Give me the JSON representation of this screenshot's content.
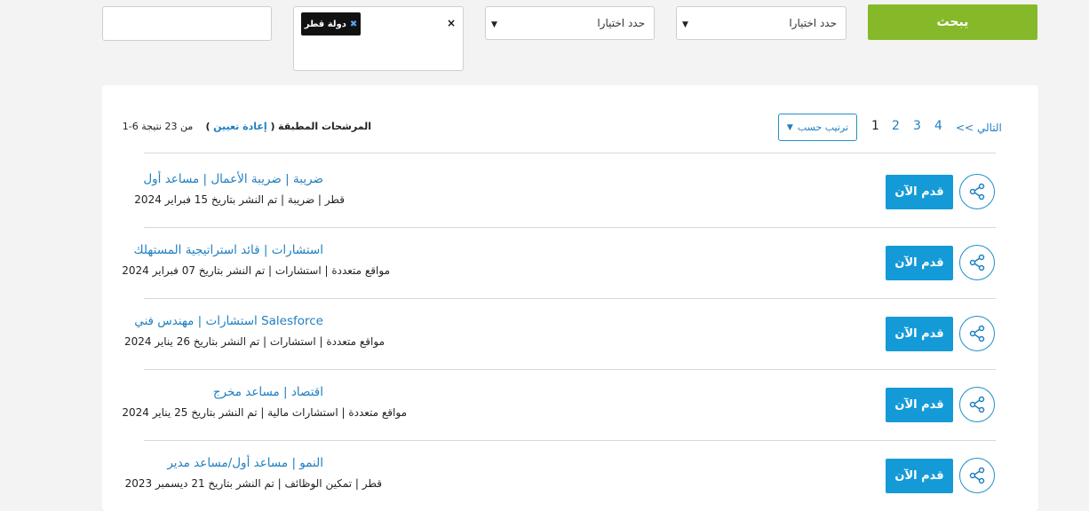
{
  "filters": {
    "search_label": "يبحث",
    "select1_placeholder": "حدد اختيارا",
    "select2_placeholder": "حدد اختيارا",
    "location_tag": "دولة قطر",
    "keyword_value": ""
  },
  "results": {
    "title": "المرشحات المطبقة",
    "reset_label": "إعادة تعيين",
    "count_text": "من 23 نتيجة 6-1",
    "sort_label": "ترتيب حسب",
    "pages": [
      "1",
      "2",
      "3",
      "4"
    ],
    "next_label": "<< التالي"
  },
  "jobs": [
    {
      "title": "ضريبة | ضريبة الأعمال | مساعد أول",
      "meta": "قطر | ضريبة | تم النشر بتاريخ 15 فبراير 2024",
      "apply_label": "قدم الآن"
    },
    {
      "title": "استشارات | قائد استراتيجية المستهلك",
      "meta": "مواقع متعددة | استشارات | تم النشر بتاريخ 07 فبراير 2024",
      "apply_label": "قدم الآن"
    },
    {
      "title": "Salesforce استشارات | مهندس فني",
      "meta": "مواقع متعددة | استشارات | تم النشر بتاريخ 26 يناير 2024",
      "apply_label": "قدم الآن"
    },
    {
      "title": "اقتصاد | مساعد مخرج",
      "meta": "مواقع متعددة | استشارات مالية | تم النشر بتاريخ 25 يناير 2024",
      "apply_label": "قدم الآن"
    },
    {
      "title": "النمو | مساعد أول/مساعد مدير",
      "meta": "قطر | تمكين الوظائف | تم النشر بتاريخ 21 ديسمبر 2023",
      "apply_label": "قدم الآن"
    }
  ],
  "colors": {
    "accent": "#1f7fc1",
    "search": "#86b92a",
    "apply": "#149ad7"
  }
}
